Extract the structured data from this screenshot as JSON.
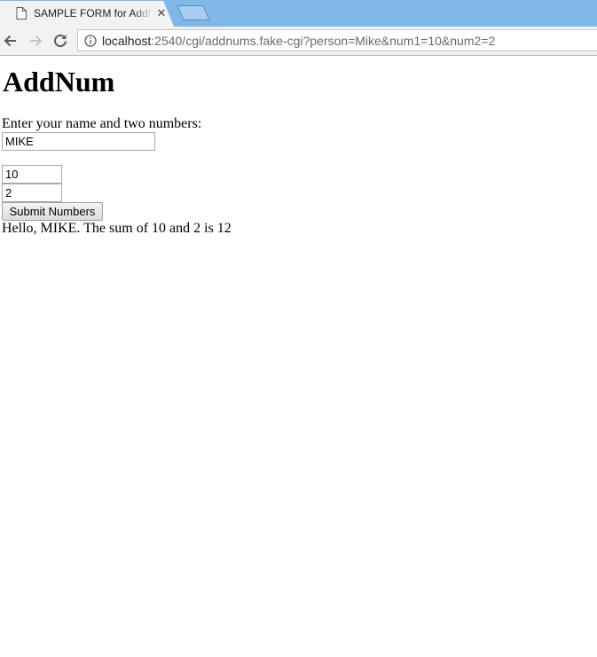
{
  "browser": {
    "tab": {
      "title": "SAMPLE FORM for AddNums",
      "close_label": "✕"
    },
    "address_bar": {
      "host": "localhost",
      "rest": ":2540/cgi/addnums.fake-cgi?person=Mike&num1=10&num2=2"
    }
  },
  "page": {
    "heading": "AddNum",
    "prompt": "Enter your name and two numbers:",
    "form": {
      "person_value": "MIKE",
      "num1_value": "10",
      "num2_value": "2",
      "submit_label": "Submit Numbers"
    },
    "result": "Hello, MIKE. The sum of 10 and 2 is 12"
  },
  "icons": {
    "tab_favicon": "page-icon",
    "tab_close": "close-icon",
    "new_tab": "new-tab-icon",
    "back": "back-arrow-icon",
    "forward": "forward-arrow-icon",
    "reload": "reload-icon",
    "site_info": "info-icon"
  },
  "colors": {
    "tabstrip": "#7db8e8",
    "toolbar": "#f2f2f2",
    "url_host": "#222222",
    "url_rest": "#6a6a6a"
  }
}
